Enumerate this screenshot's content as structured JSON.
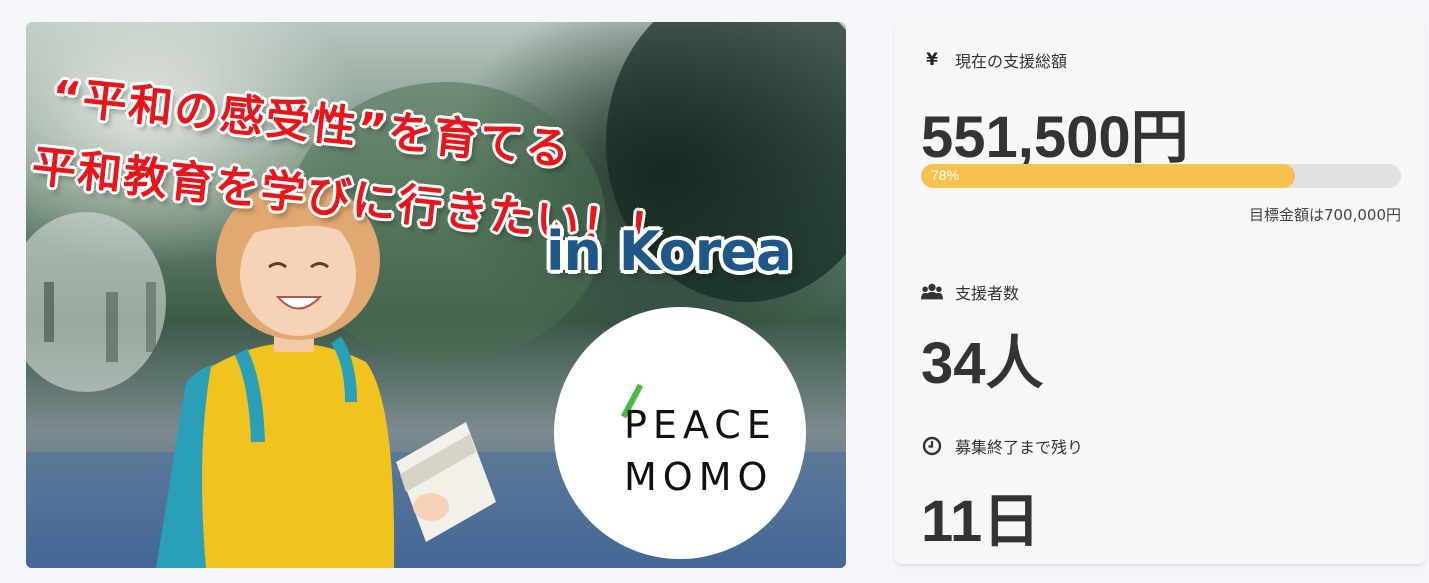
{
  "hero": {
    "title_line1": "“平和の感受性”を育てる",
    "title_line2": "平和教育を学びに行きたい！！",
    "subtitle": "in Korea",
    "logo_line1": "PEACE",
    "logo_line2": "MOMO"
  },
  "stats": {
    "total": {
      "icon": "yen-icon",
      "label": "現在の支援総額",
      "value": "551,500円",
      "progress_percent": 78,
      "progress_label": "78%",
      "goal": "目標金額は700,000円"
    },
    "supporters": {
      "icon": "users-icon",
      "label": "支援者数",
      "value": "34人"
    },
    "remaining": {
      "icon": "clock-icon",
      "label": "募集終了まで残り",
      "value": "11日"
    }
  },
  "colors": {
    "progress_fill": "#f5c24d",
    "progress_track": "#e0e1e3",
    "title_red": "#e8161b",
    "korea_blue": "#1e5788",
    "logo_green": "#4db84a"
  }
}
